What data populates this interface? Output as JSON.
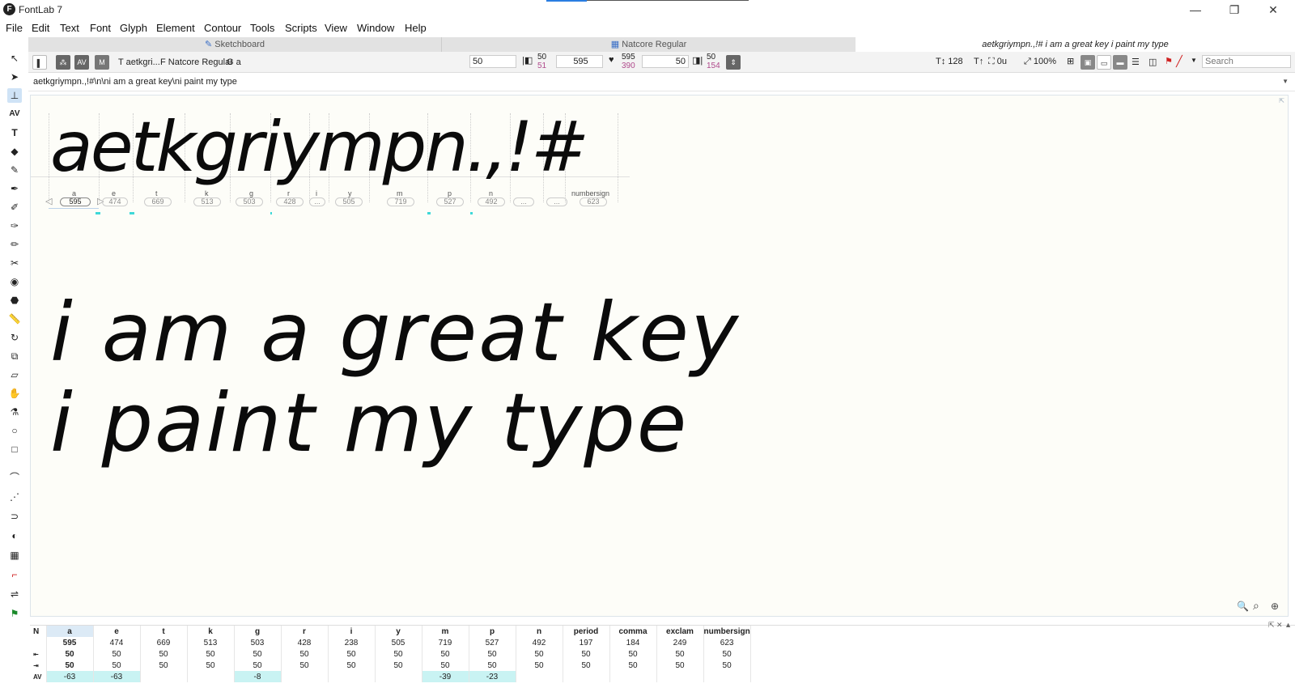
{
  "window": {
    "title": "FontLab 7",
    "logo": "F",
    "controls": [
      "—",
      "❐",
      "✕"
    ]
  },
  "menu": [
    "File",
    "Edit",
    "Text",
    "Font",
    "Glyph",
    "Element",
    "Contour",
    "Tools",
    "Scripts",
    "View",
    "Window",
    "Help"
  ],
  "tabs": [
    {
      "label": "Sketchboard",
      "icon": "pencil-icon"
    },
    {
      "label": "Natcore Regular",
      "icon": "grid-icon"
    },
    {
      "label": "aetkgriympn.,!#  i am a great key i paint my type",
      "icon": ""
    }
  ],
  "propbar": {
    "mode_buttons": [
      "⁂",
      "AV",
      "M"
    ],
    "text_label": "aetkgri...",
    "font_label": "Natcore Regular",
    "glyph_label": "a",
    "lsb_value": "50",
    "lsb_small": "50",
    "lsb_small2": "51",
    "width_value": "595",
    "width_small": "595",
    "width_small2": "390",
    "rsb_value": "50",
    "rsb_small": "50",
    "rsb_small2": "154",
    "size_value": "128",
    "units_value": "0u",
    "zoom_value": "100%",
    "search_placeholder": "Search"
  },
  "text_string": "aetkgriympn.,!#\\n\\ni am a great key\\ni paint my type",
  "canvas": {
    "line1": "aetkgriympn.,!#",
    "line2": "i am a great key",
    "line3": "i paint my type",
    "glyph_labels": [
      {
        "name": "a",
        "width": "595"
      },
      {
        "name": "e",
        "width": "474"
      },
      {
        "name": "t",
        "width": "669"
      },
      {
        "name": "k",
        "width": "513"
      },
      {
        "name": "g",
        "width": "503"
      },
      {
        "name": "r",
        "width": "428"
      },
      {
        "name": "i",
        "width": "..."
      },
      {
        "name": "y",
        "width": "505"
      },
      {
        "name": "m",
        "width": "719"
      },
      {
        "name": "p",
        "width": "527"
      },
      {
        "name": "n",
        "width": "492"
      },
      {
        "name": "",
        "width": "..."
      },
      {
        "name": "",
        "width": "..."
      },
      {
        "name": "numbersign",
        "width": "623"
      }
    ]
  },
  "metrics": {
    "row_labels": [
      "N",
      "",
      "⇤",
      "⇥",
      "AV"
    ],
    "glyphs": [
      "a",
      "e",
      "t",
      "k",
      "g",
      "r",
      "i",
      "y",
      "m",
      "p",
      "n",
      "period",
      "comma",
      "exclam",
      "numbersign"
    ],
    "widths": [
      "595",
      "474",
      "669",
      "513",
      "503",
      "428",
      "238",
      "505",
      "719",
      "527",
      "492",
      "197",
      "184",
      "249",
      "623"
    ],
    "lsb": [
      "50",
      "50",
      "50",
      "50",
      "50",
      "50",
      "50",
      "50",
      "50",
      "50",
      "50",
      "50",
      "50",
      "50",
      "50"
    ],
    "rsb": [
      "50",
      "50",
      "50",
      "50",
      "50",
      "50",
      "50",
      "50",
      "50",
      "50",
      "50",
      "50",
      "50",
      "50",
      "50"
    ],
    "kern": [
      "-63",
      "-63",
      "",
      "",
      "-8",
      "",
      "",
      "",
      "-39",
      "-23",
      "",
      "",
      "",
      "",
      ""
    ],
    "panel_controls": "⇱  ✕  ▲"
  }
}
